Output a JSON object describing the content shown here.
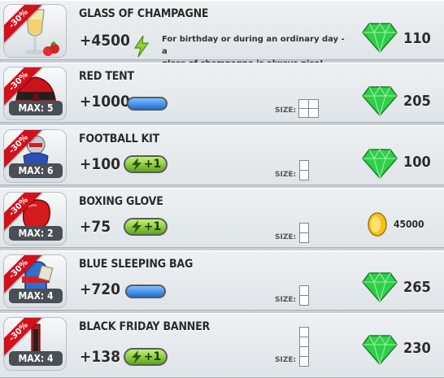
{
  "items": [
    {
      "discount": "-30%",
      "name": "GLASS OF CHAMPAGNE",
      "bonus": "+4500",
      "extra": "energy-bolt-icon",
      "description_line1": "For birthday or during an ordinary day - a",
      "description_line2": "glass of champagne is always nice!",
      "max": "",
      "size_label": "",
      "size_shape": "none",
      "currency": "gem",
      "price": "110"
    },
    {
      "discount": "-30%",
      "name": "RED TENT",
      "bonus": "+1000",
      "extra": "blue-bar",
      "max": "MAX: 5",
      "size_label": "SIZE:",
      "size_shape": "2x2",
      "currency": "gem",
      "price": "205"
    },
    {
      "discount": "-30%",
      "name": "FOOTBALL KIT",
      "bonus": "+100",
      "extra": "green-pill",
      "pill_text": "+1",
      "max": "MAX: 6",
      "size_label": "SIZE:",
      "size_shape": "1x2",
      "currency": "gem",
      "price": "100"
    },
    {
      "discount": "-30%",
      "name": "BOXING GLOVE",
      "bonus": "+75",
      "extra": "green-pill",
      "pill_text": "+1",
      "max": "MAX: 2",
      "size_label": "SIZE:",
      "size_shape": "1x2",
      "currency": "coin",
      "price": "45000"
    },
    {
      "discount": "-30%",
      "name": "BLUE SLEEPING BAG",
      "bonus": "+720",
      "extra": "blue-bar",
      "max": "MAX: 4",
      "size_label": "SIZE:",
      "size_shape": "1x2",
      "currency": "gem",
      "price": "265"
    },
    {
      "discount": "-30%",
      "name": "BLACK FRIDAY BANNER",
      "bonus": "+138",
      "extra": "green-pill",
      "pill_text": "+1",
      "max": "MAX: 4",
      "size_label": "SIZE:",
      "size_shape": "1x4",
      "currency": "gem",
      "price": "230"
    }
  ],
  "colors": {
    "gem": "#2fcf4a",
    "coin": "#f2c21b",
    "ribbon": "#d4101b",
    "blue_bar": "#1f6fd6",
    "green_pill": "#7ccf2a"
  }
}
